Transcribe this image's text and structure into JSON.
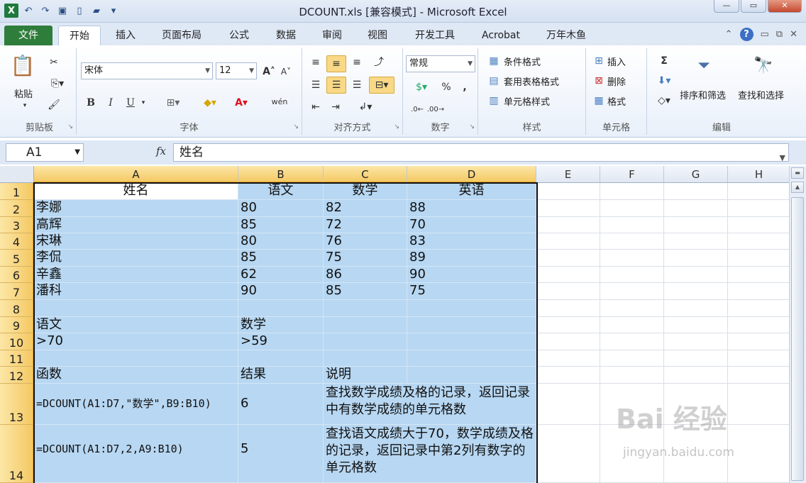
{
  "window": {
    "title": "DCOUNT.xls  [兼容模式] - Microsoft Excel",
    "controls": {
      "minimize": "—",
      "restore": "▭",
      "close": "✕"
    }
  },
  "ribbon_tabs": [
    "文件",
    "开始",
    "插入",
    "页面布局",
    "公式",
    "数据",
    "审阅",
    "视图",
    "开发工具",
    "Acrobat",
    "万年木鱼"
  ],
  "active_tab": "开始",
  "ribbon": {
    "clipboard": {
      "paste": "粘贴",
      "label": "剪贴板"
    },
    "font": {
      "name": "宋体",
      "size": "12",
      "bold": "B",
      "italic": "I",
      "underline": "U",
      "wen": "wén",
      "label": "字体"
    },
    "alignment": {
      "label": "对齐方式"
    },
    "number": {
      "format": "常规",
      "percent": "%",
      "comma": ",",
      "label": "数字"
    },
    "styles": {
      "conditional": "条件格式",
      "table": "套用表格格式",
      "cell": "单元格样式",
      "label": "样式"
    },
    "cells": {
      "insert": "插入",
      "delete": "删除",
      "format": "格式",
      "label": "单元格"
    },
    "editing": {
      "sigma": "Σ",
      "sort": "排序和筛选",
      "find": "查找和选择",
      "label": "编辑"
    }
  },
  "formula_bar": {
    "name_box": "A1",
    "fx": "fx",
    "value": "姓名"
  },
  "columns": [
    "A",
    "B",
    "C",
    "D",
    "E",
    "F",
    "G",
    "H"
  ],
  "rows": [
    "1",
    "2",
    "3",
    "4",
    "5",
    "6",
    "7",
    "8",
    "9",
    "10",
    "11",
    "12",
    "13",
    "14"
  ],
  "cells": {
    "r1": [
      "姓名",
      "语文",
      "数学",
      "英语"
    ],
    "r2": [
      "李娜",
      "80",
      "82",
      "88"
    ],
    "r3": [
      "高辉",
      "85",
      "72",
      "70"
    ],
    "r4": [
      "宋琳",
      "80",
      "76",
      "83"
    ],
    "r5": [
      "李侃",
      "85",
      "75",
      "89"
    ],
    "r6": [
      "辛鑫",
      "62",
      "86",
      "90"
    ],
    "r7": [
      "潘科",
      "90",
      "85",
      "75"
    ],
    "r8": [
      "",
      "",
      "",
      ""
    ],
    "r9": [
      "语文",
      "数学",
      "",
      ""
    ],
    "r10": [
      ">70",
      ">59",
      "",
      ""
    ],
    "r11": [
      "",
      "",
      "",
      ""
    ],
    "r12": [
      "函数",
      "结果",
      "说明",
      ""
    ],
    "r13": [
      "=DCOUNT(A1:D7,\"数学\",B9:B10)",
      "6",
      "查找数学成绩及格的记录，返回记录中有数学成绩的单元格数",
      ""
    ],
    "r14": [
      "=DCOUNT(A1:D7,2,A9:B10)",
      "5",
      "查找语文成绩大于70，数学成绩及格的记录，返回记录中第2列有数字的单元格数",
      ""
    ]
  },
  "watermark": {
    "text": "Bai 经验",
    "url": "jingyan.baidu.com"
  }
}
